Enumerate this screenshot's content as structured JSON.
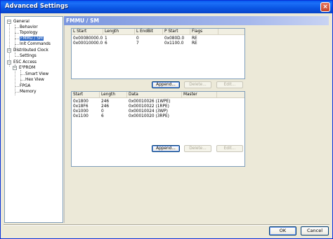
{
  "window": {
    "title": "Advanced Settings",
    "close_glyph": "×"
  },
  "tree": {
    "items": [
      {
        "label": "General",
        "expander": "−"
      },
      {
        "label": "Behavior"
      },
      {
        "label": "Topology"
      },
      {
        "label": "FMMU / SM",
        "selected": true
      },
      {
        "label": "Init Commands"
      },
      {
        "label": "Distributed Clock",
        "expander": "−"
      },
      {
        "label": "Settings"
      },
      {
        "label": "ESC Access",
        "expander": "−"
      },
      {
        "label": "E²PROM",
        "expander": "−"
      },
      {
        "label": "Smart View"
      },
      {
        "label": "Hex View"
      },
      {
        "label": "FPGA"
      },
      {
        "label": "Memory"
      }
    ]
  },
  "pane": {
    "title": "FMMU / SM"
  },
  "fmmu_table": {
    "columns": [
      "L Start",
      "Length",
      "L EndBit",
      "P Start",
      "Flags"
    ],
    "rows": [
      [
        "0x00080000.0",
        "1",
        "0",
        "0x080D.0",
        "RE"
      ],
      [
        "0x00010000.0",
        "6",
        "7",
        "0x1100.0",
        "RE"
      ]
    ]
  },
  "fmmu_buttons": {
    "append": "Append...",
    "delete": "Delete...",
    "edit": "Edit..."
  },
  "sm_table": {
    "columns": [
      "Start",
      "Length",
      "Data",
      "Master"
    ],
    "rows": [
      [
        "0x1800",
        "246",
        "0x00010026 (1WPE)",
        ""
      ],
      [
        "0x18F6",
        "246",
        "0x00010022 (1RPE)",
        ""
      ],
      [
        "0x1000",
        "0",
        "0x00010024 (3WP)",
        ""
      ],
      [
        "0x1100",
        "6",
        "0x00010020 (3RPE)",
        ""
      ]
    ]
  },
  "sm_buttons": {
    "append": "Append...",
    "delete": "Delete...",
    "edit": "Edit..."
  },
  "dialog_buttons": {
    "ok": "OK",
    "cancel": "Cancel"
  }
}
